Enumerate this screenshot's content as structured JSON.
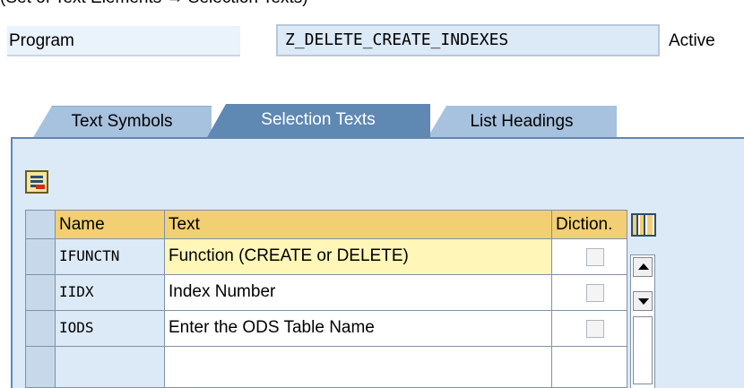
{
  "caption": "(Set of Text Elements → Selection Texts)",
  "program": {
    "label": "Program",
    "value": "Z_DELETE_CREATE_INDEXES",
    "status": "Active"
  },
  "tabs": [
    {
      "label": "Text Symbols",
      "active": false
    },
    {
      "label": "Selection Texts",
      "active": true
    },
    {
      "label": "List Headings",
      "active": false
    }
  ],
  "grid": {
    "columns": [
      "Name",
      "Text",
      "Diction."
    ],
    "rows": [
      {
        "name": "IFUNCTN",
        "text": "Function (CREATE or DELETE)",
        "dictionary": false,
        "focused": true
      },
      {
        "name": "IIDX",
        "text": "Index Number",
        "dictionary": false,
        "focused": false
      },
      {
        "name": "IODS",
        "text": "Enter the ODS Table Name",
        "dictionary": false,
        "focused": false
      },
      {
        "name": "",
        "text": "",
        "dictionary": null,
        "focused": false
      }
    ]
  },
  "icons": {
    "toolbar": "table-insert-icon",
    "column_config": "column-settings-icon",
    "scroll_up": "scroll-up-icon",
    "scroll_down": "scroll-down-icon"
  },
  "colors": {
    "active_tab": "#5f88b2",
    "inactive_tab": "#a7c2de",
    "panel": "#dce9f6",
    "header": "#f2cf72",
    "focus_row": "#fff6b8"
  }
}
